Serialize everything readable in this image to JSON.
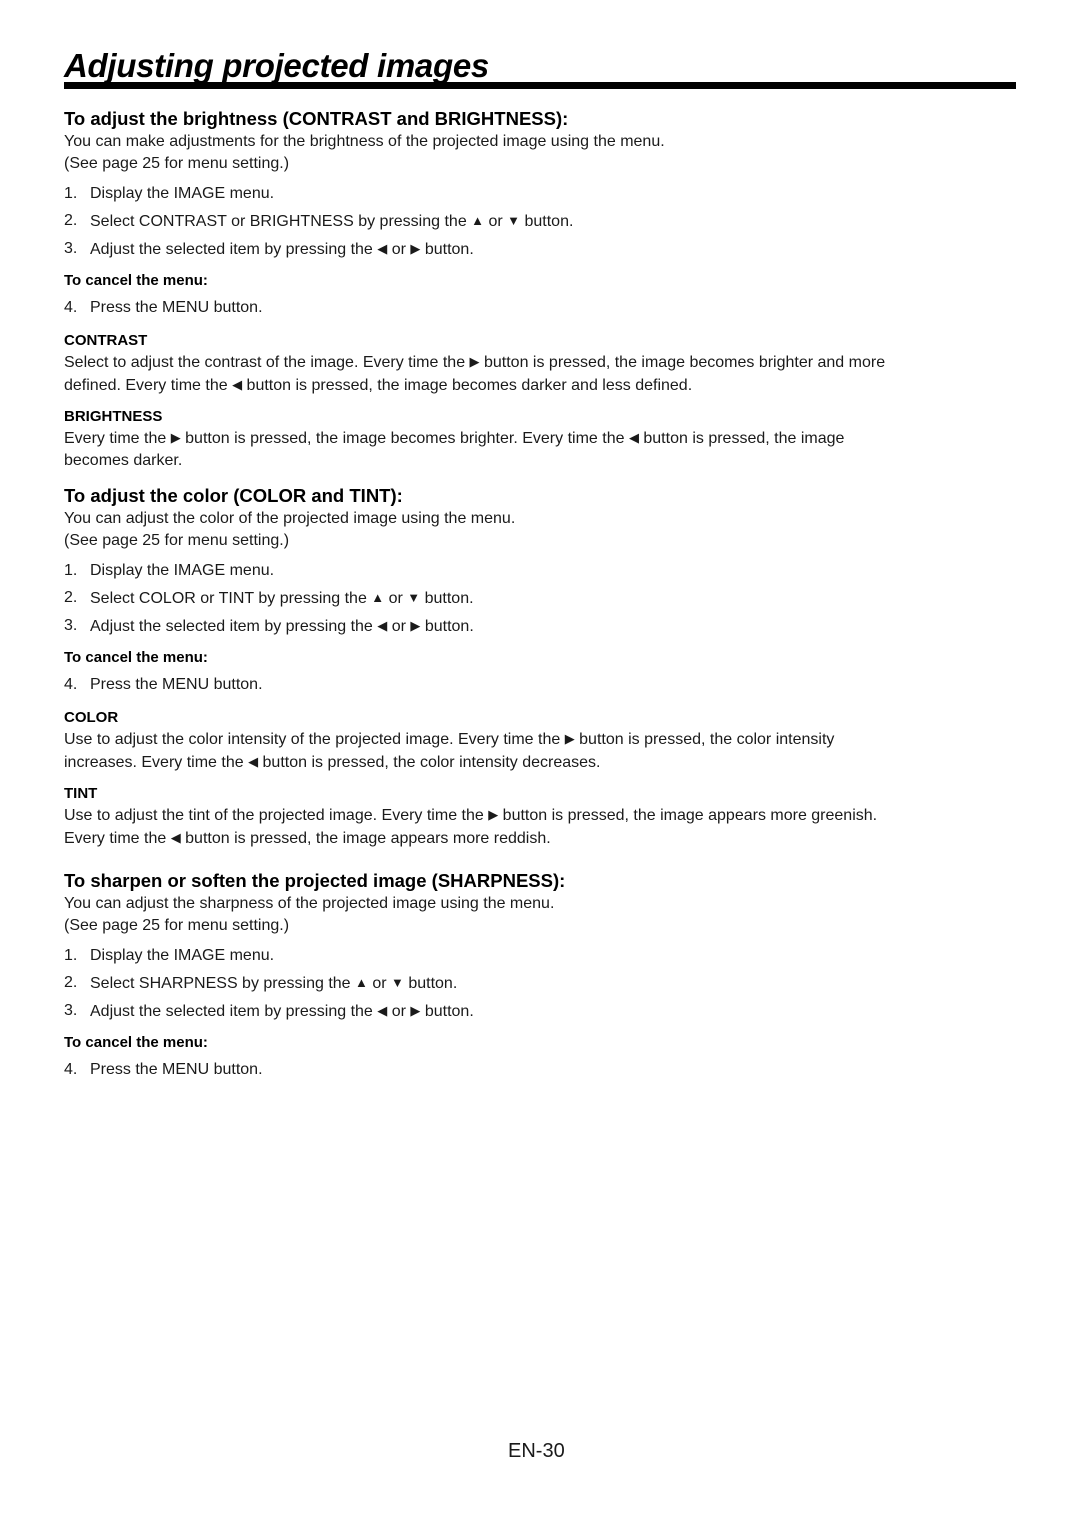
{
  "title": "Adjusting projected images",
  "sections": [
    {
      "heading": "To adjust the brightness (CONTRAST and BRIGHTNESS):",
      "intro": [
        "You can make adjustments for the brightness of the projected image using the menu.",
        "(See page 25 for menu setting.)"
      ],
      "steps": [
        {
          "num": "1.",
          "text": "Display the IMAGE menu."
        },
        {
          "num": "2.",
          "pre": "Select CONTRAST or BRIGHTNESS by pressing the ",
          "icon1": "▲",
          "mid": " or ",
          "icon2": "▼",
          "post": " button."
        },
        {
          "num": "3.",
          "pre": "Adjust the selected item by pressing the ",
          "icon1": "◀",
          "mid": " or ",
          "icon2": "▶",
          "post": " button."
        }
      ],
      "cancel_label": "To cancel the menu:",
      "cancel_step": {
        "num": "4.",
        "text": "Press the MENU button."
      },
      "items": [
        {
          "label": "CONTRAST",
          "lines": [
            {
              "pre": "Select to adjust the contrast of the image. Every time the ",
              "icon": "▶",
              "post": " button is pressed, the image becomes brighter and more"
            },
            {
              "pre": "defined. Every time the ",
              "icon": "◀",
              "post": " button is pressed, the image becomes darker and less defined."
            }
          ]
        },
        {
          "label": "BRIGHTNESS",
          "lines": [
            {
              "pre": "Every time the ",
              "icon": "▶",
              "post": " button is pressed, the image becomes brighter. Every time the ",
              "icon2": "◀",
              "post2": " button is pressed, the image"
            },
            {
              "pre": "becomes darker."
            }
          ]
        }
      ]
    },
    {
      "heading": "To adjust the color (COLOR and TINT):",
      "intro": [
        "You can adjust the color of the projected image using the menu.",
        "(See page 25 for menu setting.)"
      ],
      "steps": [
        {
          "num": "1.",
          "text": "Display the IMAGE menu."
        },
        {
          "num": "2.",
          "pre": "Select COLOR or TINT by pressing the ",
          "icon1": "▲",
          "mid": " or ",
          "icon2": "▼",
          "post": " button."
        },
        {
          "num": "3.",
          "pre": "Adjust the selected item by pressing the ",
          "icon1": "◀",
          "mid": " or ",
          "icon2": "▶",
          "post": " button."
        }
      ],
      "cancel_label": "To cancel the menu:",
      "cancel_step": {
        "num": "4.",
        "text": "Press the MENU button."
      },
      "items": [
        {
          "label": "COLOR",
          "lines": [
            {
              "pre": "Use to adjust the color intensity of the projected image. Every time the ",
              "icon": "▶",
              "post": " button is pressed, the color intensity"
            },
            {
              "pre": "increases. Every time the ",
              "icon": "◀",
              "post": " button is pressed, the color intensity decreases."
            }
          ]
        },
        {
          "label": "TINT",
          "lines": [
            {
              "pre": "Use to adjust the tint of the projected image. Every time the ",
              "icon": "▶",
              "post": " button is pressed, the image appears more greenish."
            },
            {
              "pre": "Every time the ",
              "icon": "◀",
              "post": " button is pressed, the image appears more reddish."
            }
          ]
        }
      ]
    },
    {
      "heading": "To sharpen or soften the projected image (SHARPNESS):",
      "intro": [
        "You can adjust the sharpness of the projected image using the menu.",
        "(See page 25 for menu setting.)"
      ],
      "steps": [
        {
          "num": "1.",
          "text": "Display the IMAGE menu."
        },
        {
          "num": "2.",
          "pre": "Select SHARPNESS by pressing the ",
          "icon1": "▲",
          "mid": " or ",
          "icon2": "▼",
          "post": " button."
        },
        {
          "num": "3.",
          "pre": "Adjust the selected item by pressing the ",
          "icon1": "◀",
          "mid": " or ",
          "icon2": "▶",
          "post": " button."
        }
      ],
      "cancel_label": "To cancel the menu:",
      "cancel_step": {
        "num": "4.",
        "text": "Press the MENU button."
      }
    }
  ],
  "footer": {
    "page_number": "EN-30"
  }
}
